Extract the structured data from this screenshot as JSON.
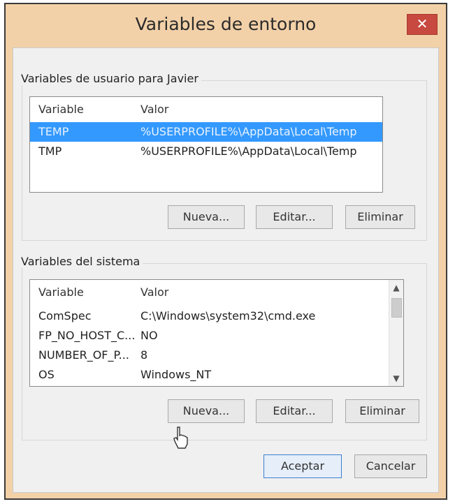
{
  "window": {
    "title": "Variables de entorno",
    "close_symbol": "✕"
  },
  "user_section": {
    "label": "Variables de usuario para Javier",
    "columns": [
      "Variable",
      "Valor"
    ],
    "rows": [
      {
        "variable": "TEMP",
        "value": "%USERPROFILE%\\AppData\\Local\\Temp",
        "selected": true
      },
      {
        "variable": "TMP",
        "value": "%USERPROFILE%\\AppData\\Local\\Temp",
        "selected": false
      }
    ],
    "buttons": {
      "new": "Nueva...",
      "edit": "Editar...",
      "delete": "Eliminar"
    }
  },
  "system_section": {
    "label": "Variables del sistema",
    "columns": [
      "Variable",
      "Valor"
    ],
    "rows": [
      {
        "variable": "ComSpec",
        "value": "C:\\Windows\\system32\\cmd.exe"
      },
      {
        "variable": "FP_NO_HOST_C...",
        "value": "NO"
      },
      {
        "variable": "NUMBER_OF_P...",
        "value": "8"
      },
      {
        "variable": "OS",
        "value": "Windows_NT"
      }
    ],
    "buttons": {
      "new": "Nueva...",
      "edit": "Editar...",
      "delete": "Eliminar"
    }
  },
  "footer": {
    "ok": "Aceptar",
    "cancel": "Cancelar"
  },
  "colors": {
    "titlebar": "#f3d1a8",
    "selection": "#3399ff",
    "close": "#c7493f"
  }
}
